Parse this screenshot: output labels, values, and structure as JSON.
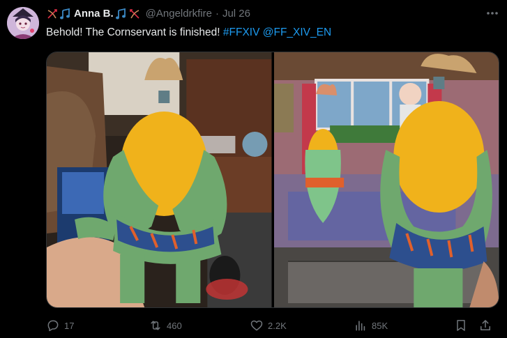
{
  "tweet": {
    "author": {
      "display_name": "Anna B.",
      "handle": "@Angeldrkfire",
      "date": "Jul 26",
      "separator": "·",
      "avatar_icon": "anime-character-avatar"
    },
    "text": {
      "body": "Behold! The Cornservant is finished! ",
      "hashtag": "#FFXIV",
      "space": " ",
      "mention": "@FF_XIV_EN"
    },
    "media": [
      {
        "icon": "crochet-corn-plush-photo"
      },
      {
        "icon": "crochet-corn-plush-with-game-screen-photo"
      }
    ],
    "actions": {
      "reply_count": "17",
      "repost_count": "460",
      "like_count": "2.2K",
      "views_count": "85K"
    }
  },
  "colors": {
    "background": "#000000",
    "text": "#e7e9ea",
    "muted": "#71767b",
    "link": "#1d9bf0",
    "border": "#2f3336",
    "emoji_blue": "#3b88c3",
    "emoji_red": "#dd2e44"
  }
}
